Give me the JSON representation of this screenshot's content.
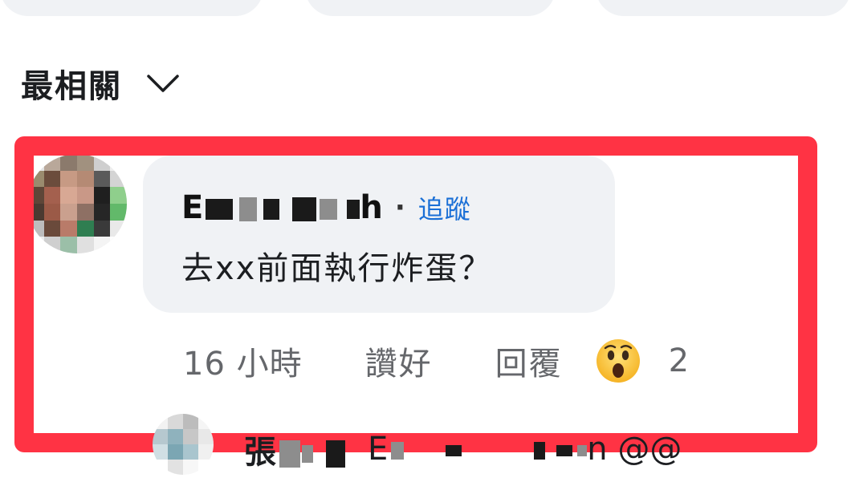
{
  "sort": {
    "label": "最相關",
    "icon": "chevron-down-icon"
  },
  "comment": {
    "author": {
      "first_letter": "E",
      "tail_letter": "h",
      "name_redacted": true
    },
    "follow_label": "追蹤",
    "separator": "·",
    "text": "去xx前面執行炸蛋？",
    "time": "16 小時",
    "like_label": "讚好",
    "reply_label": "回覆",
    "reaction": {
      "icon": "wow-emoji-icon",
      "count": "2"
    }
  },
  "reply": {
    "author_first_char": "張",
    "mention_first_letter": "E",
    "mention_tail": "n",
    "trailing_text": "@@"
  },
  "colors": {
    "highlight": "#ff3344",
    "link": "#1a6fd6",
    "bubble": "#f0f2f5",
    "secondary_text": "#65676b"
  }
}
